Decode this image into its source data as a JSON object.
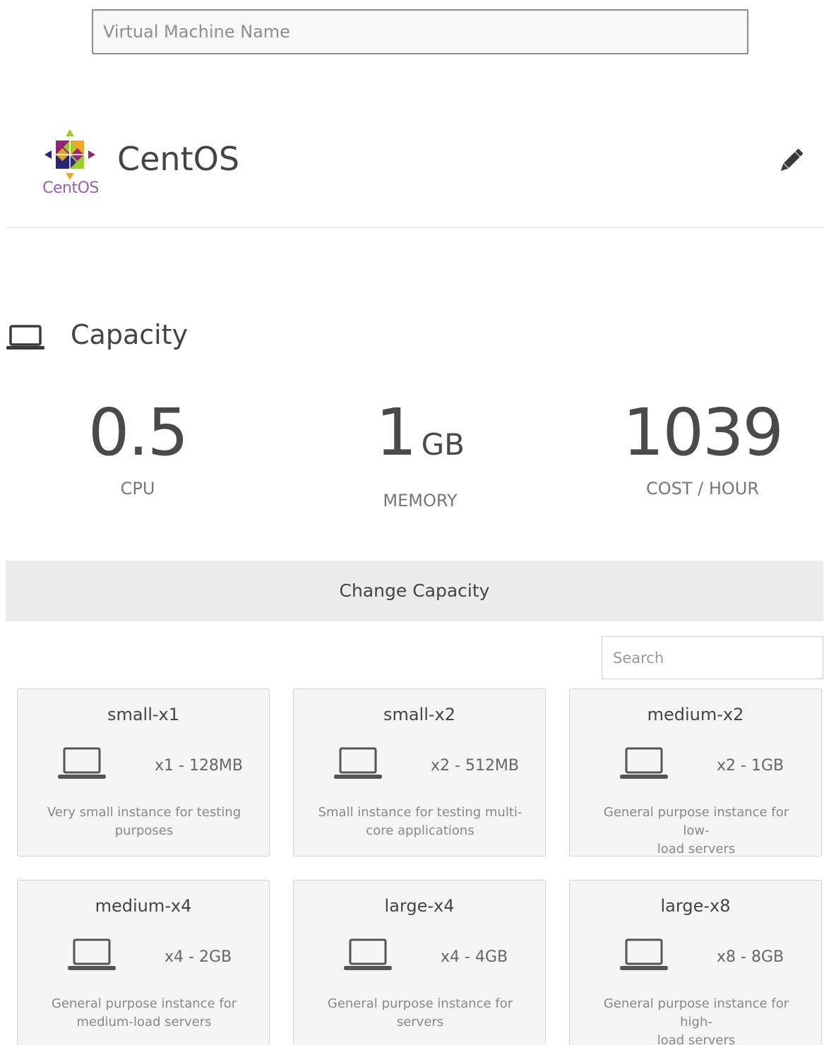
{
  "vm_name": {
    "placeholder": "Virtual Machine Name",
    "value": ""
  },
  "os": {
    "name": "CentOS",
    "logo_text": "CentOS",
    "edit_icon": "pencil-icon"
  },
  "capacity": {
    "title": "Capacity",
    "icon": "laptop-icon",
    "cpu": {
      "value": "0.5",
      "label": "CPU"
    },
    "memory": {
      "value": "1",
      "unit": "GB",
      "label": "MEMORY"
    },
    "cost": {
      "value": "1039",
      "label": "COST / HOUR"
    },
    "change_button": "Change Capacity"
  },
  "search": {
    "placeholder": "Search"
  },
  "instances": [
    {
      "name": "small-x1",
      "spec": "x1 - 128MB",
      "desc_line1": "Very small instance for testing",
      "desc_line2": "purposes"
    },
    {
      "name": "small-x2",
      "spec": "x2 - 512MB",
      "desc_line1": "Small instance for testing multi-",
      "desc_line2": "core applications"
    },
    {
      "name": "medium-x2",
      "spec": "x2 - 1GB",
      "desc_line1": "General purpose instance for low-",
      "desc_line2": "load servers"
    },
    {
      "name": "medium-x4",
      "spec": "x4 - 2GB",
      "desc_line1": "General purpose instance for",
      "desc_line2": "medium-load servers"
    },
    {
      "name": "large-x4",
      "spec": "x4 - 4GB",
      "desc_line1": "General purpose instance for",
      "desc_line2": "servers"
    },
    {
      "name": "large-x8",
      "spec": "x8 - 8GB",
      "desc_line1": "General purpose instance for high-",
      "desc_line2": "load servers"
    }
  ],
  "colors": {
    "card_bg": "#f5f5f5",
    "button_bg": "#ececec",
    "centos_purple": "#9a5fb0",
    "text_dark": "#444444"
  }
}
